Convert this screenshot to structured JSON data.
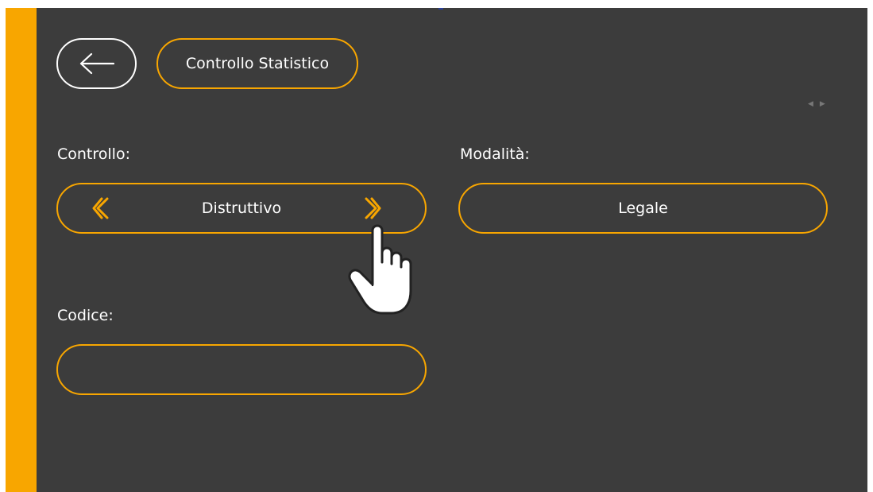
{
  "header": {
    "back_icon": "arrow-left-icon",
    "title": "Controllo Statistico"
  },
  "controllo": {
    "label": "Controllo:",
    "value": "Distruttivo",
    "prev_icon": "chevron-left-icon",
    "next_icon": "chevron-right-icon"
  },
  "modalita": {
    "label": "Modalità:",
    "value": "Legale"
  },
  "codice": {
    "label": "Codice:",
    "value": ""
  },
  "cursor": {
    "icon": "hand-pointer-icon"
  },
  "colors": {
    "accent": "#f8a600",
    "background": "#3c3c3c",
    "text": "#ffffff"
  }
}
